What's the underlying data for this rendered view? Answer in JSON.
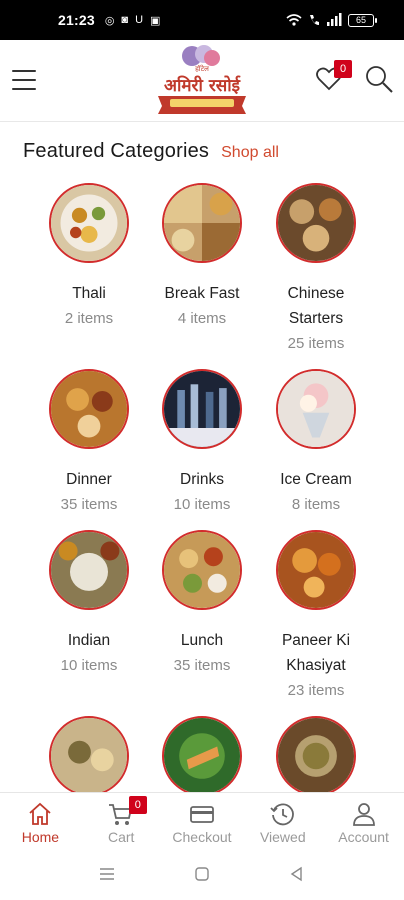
{
  "status_bar": {
    "time": "21:23",
    "battery": "65"
  },
  "header": {
    "logo_text": "अमिरी रसोई",
    "wishlist_count": "0"
  },
  "section": {
    "title": "Featured Categories",
    "shop_all": "Shop all"
  },
  "categories": [
    {
      "name": "Thali",
      "count": "2 items",
      "bg": "#d9c7a4",
      "accent": "#c98a22"
    },
    {
      "name": "Break Fast",
      "count": "4 items",
      "bg": "#c7a06b",
      "accent": "#8a5a2b"
    },
    {
      "name": "Chinese Starters",
      "name_line1": "Chinese",
      "name_line2": "Starters",
      "count": "25 items",
      "bg": "#6b4a2c",
      "accent": "#b97a3a"
    },
    {
      "name": "Dinner",
      "count": "35 items",
      "bg": "#b9762e",
      "accent": "#e0a34a"
    },
    {
      "name": "Drinks",
      "count": "10 items",
      "bg": "#1c2436",
      "accent": "#6f8bb0"
    },
    {
      "name": "Ice Cream",
      "count": "8 items",
      "bg": "#e9e2dc",
      "accent": "#f4c6c8"
    },
    {
      "name": "Indian",
      "count": "10 items",
      "bg": "#8a7a52",
      "accent": "#e9e4d6"
    },
    {
      "name": "Lunch",
      "count": "35 items",
      "bg": "#c69a58",
      "accent": "#e7c27a"
    },
    {
      "name": "Paneer Ki Khasiyat",
      "name_line1": "Paneer Ki",
      "name_line2": "Khasiyat",
      "count": "23 items",
      "bg": "#a8541f",
      "accent": "#e49a3c"
    },
    {
      "name": "",
      "count": "",
      "bg": "#c9b48a",
      "accent": "#7a6a3a"
    },
    {
      "name": "",
      "count": "",
      "bg": "#2f6a2a",
      "accent": "#e79a4a"
    },
    {
      "name": "",
      "count": "",
      "bg": "#6a4a2a",
      "accent": "#b6a070"
    }
  ],
  "bottom_nav": {
    "items": [
      {
        "label": "Home",
        "icon": "home-icon"
      },
      {
        "label": "Cart",
        "icon": "cart-icon",
        "badge": "0"
      },
      {
        "label": "Checkout",
        "icon": "card-icon"
      },
      {
        "label": "Viewed",
        "icon": "history-icon"
      },
      {
        "label": "Account",
        "icon": "user-icon"
      }
    ]
  },
  "colors": {
    "accent": "#d14a2f",
    "badge": "#d0021b",
    "ring": "#d22c2c",
    "active_nav": "#c0392b"
  }
}
